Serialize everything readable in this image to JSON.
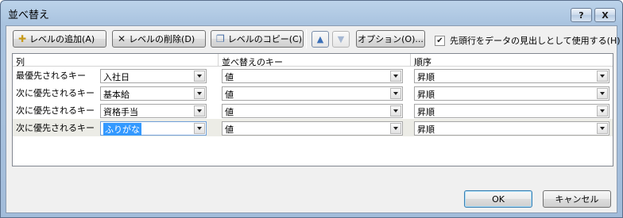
{
  "window": {
    "title": "並べ替え",
    "help": "?",
    "close": "X"
  },
  "toolbar": {
    "add_level": "レベルの追加(A)",
    "delete_level": "レベルの削除(D)",
    "copy_level": "レベルのコピー(C)",
    "move_up": "▲",
    "move_down": "▼",
    "options": "オプション(O)...",
    "header_checkbox_label": "先頭行をデータの見出しとして使用する(H)",
    "header_checkbox_checked": true
  },
  "grid": {
    "headers": {
      "column": "列",
      "sort_on": "並べ替えのキー",
      "order": "順序"
    },
    "rows": [
      {
        "label": "最優先されるキー",
        "column": "入社日",
        "sort_on": "値",
        "order": "昇順"
      },
      {
        "label": "次に優先されるキー",
        "column": "基本給",
        "sort_on": "値",
        "order": "昇順"
      },
      {
        "label": "次に優先されるキー",
        "column": "資格手当",
        "sort_on": "値",
        "order": "昇順"
      },
      {
        "label": "次に優先されるキー",
        "column": "ふりがな",
        "sort_on": "値",
        "order": "昇順"
      }
    ]
  },
  "footer": {
    "ok": "OK",
    "cancel": "キャンセル"
  }
}
